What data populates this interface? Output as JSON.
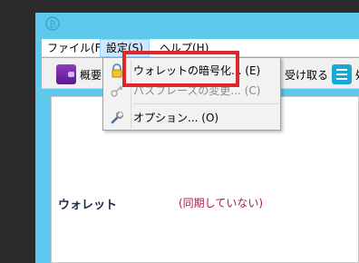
{
  "menubar": {
    "file": "ファイル(F)",
    "settings": "設定(S)",
    "help": "ヘルプ(H)"
  },
  "toolbar": {
    "overview": "概要",
    "receive": "受け取る",
    "transactions": "処"
  },
  "dropdown": {
    "encrypt_wallet": "ウォレットの暗号化... (E)",
    "change_passphrase": "パスフレーズの変更... (C)",
    "options": "オプション... (O)"
  },
  "content": {
    "wallet_label": "ウォレット",
    "sync_status": "(同期していない)"
  },
  "colors": {
    "window_frame": "#5ec9ec",
    "menu_highlight": "#cce8ff",
    "annotation_red": "#e0262b",
    "sync_status": "#b01650"
  },
  "icons": {
    "title": "bitcoin-icon",
    "overview": "wallet-icon",
    "transactions": "list-icon",
    "encrypt": "lock-icon",
    "passphrase": "key-icon",
    "options": "wrench-icon"
  }
}
